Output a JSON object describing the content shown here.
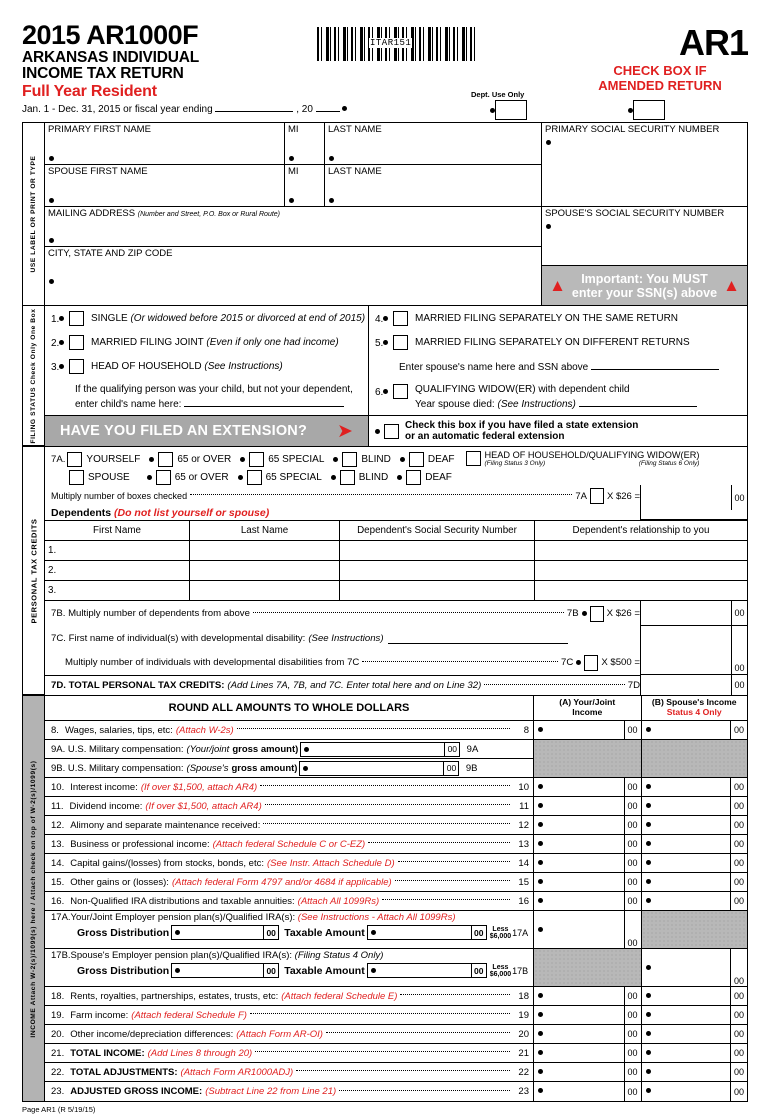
{
  "header": {
    "year_form": "2015 AR1000F",
    "title_line1": "ARKANSAS INDIVIDUAL",
    "title_line2": "INCOME TAX RETURN",
    "resident": "Full Year Resident",
    "period_pre": "Jan. 1 - Dec. 31, 2015 or fiscal year ending",
    "period_mid": ", 20",
    "barcode_label": "ITAR151",
    "form_code": "AR1",
    "amended_line1": "CHECK BOX IF",
    "amended_line2": "AMENDED RETURN",
    "dept_use": "Dept. Use Only"
  },
  "names": {
    "side_label": "USE LABEL OR PRINT OR TYPE",
    "primary_first": "PRIMARY FIRST NAME",
    "mi": "MI",
    "last_name": "LAST NAME",
    "spouse_first": "SPOUSE FIRST NAME",
    "mailing": "MAILING ADDRESS",
    "mailing_note": "(Number and Street, P.O. Box or Rural Route)",
    "city": "CITY, STATE AND ZIP CODE",
    "primary_ssn": "PRIMARY SOCIAL SECURITY NUMBER",
    "spouse_ssn": "SPOUSE'S SOCIAL SECURITY NUMBER",
    "important_line1": "Important: You MUST",
    "important_line2": "enter your SSN(s) above"
  },
  "filing_status": {
    "side_label": "FILING STATUS Check Only One Box",
    "items": [
      {
        "num": "1.",
        "label": "SINGLE",
        "note": "(Or widowed before 2015 or divorced at end of 2015)"
      },
      {
        "num": "2.",
        "label": "MARRIED FILING JOINT",
        "note": "(Even if only one had income)"
      },
      {
        "num": "3.",
        "label": "HEAD OF HOUSEHOLD",
        "note": "(See Instructions)"
      },
      {
        "num": "4.",
        "label": "MARRIED FILING SEPARATELY ON THE SAME RETURN",
        "note": ""
      },
      {
        "num": "5.",
        "label": "MARRIED FILING SEPARATELY ON DIFFERENT RETURNS",
        "note": ""
      },
      {
        "num": "6.",
        "label": "QUALIFYING WIDOW(ER) with dependent child",
        "note": ""
      }
    ],
    "child_note1": "If the qualifying person was your child, but not your dependent,",
    "child_note2": "enter child's name here:",
    "spouse_name_note": "Enter spouse's name here and SSN above",
    "year_died": "Year spouse died:",
    "year_died_note": "(See Instructions)"
  },
  "extension": {
    "banner": "HAVE YOU FILED AN EXTENSION?",
    "check_line1": "Check this box if you have filed a state extension",
    "check_line2": "or an automatic federal extension"
  },
  "credits": {
    "side_label": "PERSONAL TAX CREDITS",
    "line7a_num": "7A.",
    "row1": [
      "YOURSELF",
      "65 or OVER",
      "65 SPECIAL",
      "BLIND",
      "DEAF"
    ],
    "row2": [
      "SPOUSE",
      "65 or OVER",
      "65 SPECIAL",
      "BLIND",
      "DEAF"
    ],
    "hoh_label": "HEAD OF HOUSEHOLD/QUALIFYING WIDOW(ER)",
    "hoh_sub_left": "(Filing Status 3 Only)",
    "hoh_sub_right": "(Filing Status 6 Only)",
    "multiply_boxes": "Multiply number of boxes checked",
    "ref_7a": "7A",
    "x26": "X $26 =",
    "dependents_title": "Dependents",
    "dependents_note": "(Do not list yourself or spouse)",
    "dep_cols": [
      "First Name",
      "Last Name",
      "Dependent's Social Security Number",
      "Dependent's relationship to you"
    ],
    "dep_rows": [
      "1.",
      "2.",
      "3."
    ],
    "line7b": "7B. Multiply number of dependents from above",
    "ref_7b": "7B",
    "line7c_title": "7C. First name of individual(s) with developmental disability:",
    "line7c_note": "(See Instructions)",
    "line7c_mult": "Multiply number of individuals with developmental disabilities from 7C",
    "ref_7c": "7C",
    "x500": "X $500 =",
    "line7d_bold": "7D. TOTAL PERSONAL TAX CREDITS:",
    "line7d_note": "(Add Lines 7A, 7B, and 7C.  Enter total here and on Line 32)",
    "ref_7d": "7D",
    "cents": "00"
  },
  "income": {
    "side_label": "INCOME Attach W-2(s)/1099(s) here / Attach check on top of W-2(s)/1099(s)",
    "round_header": "ROUND ALL AMOUNTS TO WHOLE DOLLARS",
    "colA_line1": "(A) Your/Joint",
    "colA_line2": "Income",
    "colB_line1": "(B) Spouse's Income",
    "colB_line2": "Status 4 Only",
    "cents": "00",
    "lines": [
      {
        "num": "8.",
        "ref": "8",
        "text": "Wages, salaries, tips, etc:",
        "note": "(Attach W-2s)"
      },
      {
        "num": "10.",
        "ref": "10",
        "text": "Interest income:",
        "note": "(If over $1,500, attach AR4)"
      },
      {
        "num": "11.",
        "ref": "11",
        "text": "Dividend income:",
        "note": "(If over $1,500, attach AR4)"
      },
      {
        "num": "12.",
        "ref": "12",
        "text": "Alimony and separate maintenance received:",
        "note": ""
      },
      {
        "num": "13.",
        "ref": "13",
        "text": "Business or professional income:",
        "note": "(Attach federal Schedule C or C-EZ)"
      },
      {
        "num": "14.",
        "ref": "14",
        "text": "Capital gains/(losses) from stocks, bonds, etc:",
        "note": "(See Instr. Attach Schedule D)"
      },
      {
        "num": "15.",
        "ref": "15",
        "text": "Other gains or (losses):",
        "note": "(Attach federal Form 4797 and/or 4684 if applicable)"
      },
      {
        "num": "16.",
        "ref": "16",
        "text": "Non-Qualified IRA distributions and taxable annuities:",
        "note": "(Attach All 1099Rs)"
      },
      {
        "num": "18.",
        "ref": "18",
        "text": "Rents, royalties, partnerships, estates, trusts, etc:",
        "note": "(Attach federal Schedule E)"
      },
      {
        "num": "19.",
        "ref": "19",
        "text": "Farm income:",
        "note": "(Attach federal Schedule F)"
      },
      {
        "num": "20.",
        "ref": "20",
        "text": "Other income/depreciation differences:",
        "note": "(Attach Form AR-OI)"
      },
      {
        "num": "21.",
        "ref": "21",
        "text": "TOTAL INCOME:",
        "note": "(Add Lines 8 through 20)",
        "bold": true
      },
      {
        "num": "22.",
        "ref": "22",
        "text": "TOTAL ADJUSTMENTS:",
        "note": "(Attach Form AR1000ADJ)",
        "bold": true
      },
      {
        "num": "23.",
        "ref": "23",
        "text": "ADJUSTED GROSS INCOME:",
        "note": "(Subtract Line 22 from Line 21)",
        "bold": true
      }
    ],
    "mil_9a": "9A. U.S. Military compensation:",
    "mil_9a_note_i": "(Your/joint",
    "mil_9a_note_b": "gross amount)",
    "mil_9a_ref": "9A",
    "mil_9b": "9B. U.S. Military compensation:",
    "mil_9b_note_i": "(Spouse's",
    "mil_9b_note_b": "gross amount)",
    "mil_9b_ref": "9B",
    "l17a_title": "17A.Your/Joint Employer pension plan(s)/Qualified IRA(s):",
    "l17a_note": "(See Instructions - Attach All 1099Rs)",
    "l17b_title": "17B.Spouse's Employer pension plan(s)/Qualified IRA(s):",
    "l17b_note": "(Filing Status 4 Only)",
    "gross_distribution": "Gross Distribution",
    "taxable_amount": "Taxable Amount",
    "less_line1": "Less",
    "less_line2": "$6,000",
    "ref_17a": "17A",
    "ref_17b": "17B"
  },
  "footer": {
    "page": "Page AR1 (R 5/19/15)"
  },
  "colors": {
    "red": "#e02020",
    "grey_banner": "#a8a8a8",
    "grey_fill": "#b8b8b8"
  }
}
